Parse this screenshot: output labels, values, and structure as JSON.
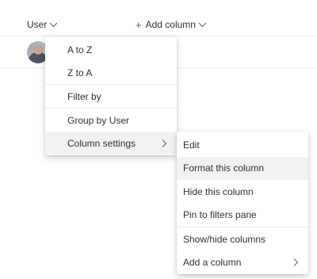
{
  "header": {
    "user_column": "User",
    "add_column": "Add column"
  },
  "row": {
    "avatar": "user avatar photo"
  },
  "column_menu": {
    "items": [
      {
        "label": "A to Z"
      },
      {
        "label": "Z to A"
      },
      {
        "label": "Filter by"
      },
      {
        "label": "Group by User"
      },
      {
        "label": "Column settings"
      }
    ]
  },
  "settings_submenu": {
    "items": [
      {
        "label": "Edit"
      },
      {
        "label": "Format this column"
      },
      {
        "label": "Hide this column"
      },
      {
        "label": "Pin to filters pane"
      },
      {
        "label": "Show/hide columns"
      },
      {
        "label": "Add a column"
      }
    ]
  },
  "icons": {
    "chevron": "chevron-down-icon",
    "arrow": "chevron-right-icon",
    "plus": "plus-icon"
  },
  "colors": {
    "text": "#323130",
    "highlight": "#f3f2f1",
    "divider": "#edebe9"
  }
}
